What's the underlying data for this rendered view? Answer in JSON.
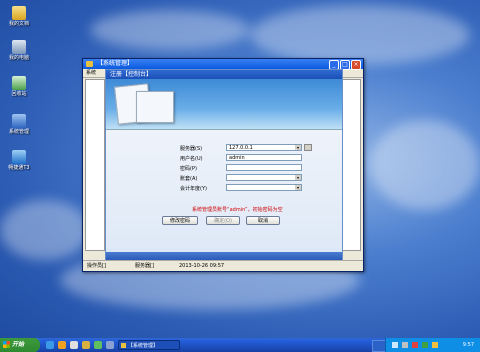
{
  "desktop": {
    "icons": [
      {
        "label": "我的文档",
        "icon": "my-documents-icon"
      },
      {
        "label": "我的电脑",
        "icon": "my-computer-icon"
      },
      {
        "label": "回收站",
        "icon": "recycle-bin-icon"
      },
      {
        "label": "系统管理",
        "icon": "system-admin-icon"
      },
      {
        "label": "畅捷通T3",
        "icon": "t3-app-icon"
      }
    ]
  },
  "outer_window": {
    "title": "【系统管理】",
    "menu": "系统",
    "controls": [
      "_",
      "□",
      "×"
    ]
  },
  "login_dialog": {
    "title": "注册【控制台】",
    "fields": {
      "server": {
        "label": "服务器(S)",
        "value": "127.0.0.1"
      },
      "username": {
        "label": "用户名(U)",
        "value": "admin"
      },
      "password": {
        "label": "密码(P)",
        "value": ""
      },
      "account": {
        "label": "账套(A)",
        "value": ""
      },
      "year": {
        "label": "会计年度(Y)",
        "value": ""
      }
    },
    "note": "系统管理员账号“admin”，初始密码为空",
    "buttons": {
      "change_password": "修改密码",
      "ok": "确定(O)",
      "cancel": "取消"
    }
  },
  "status_bar": {
    "operator": "操作员[]",
    "server": "服务器[]",
    "datetime": "2013-10-26 09:57"
  },
  "taskbar": {
    "start": "开始",
    "task": "【系统管理】",
    "clock": "9:57"
  },
  "colors": {
    "titlebar": "#0a5ae0",
    "note": "#d00000",
    "taskbar": "#245edb",
    "start": "#3c9a3c"
  }
}
